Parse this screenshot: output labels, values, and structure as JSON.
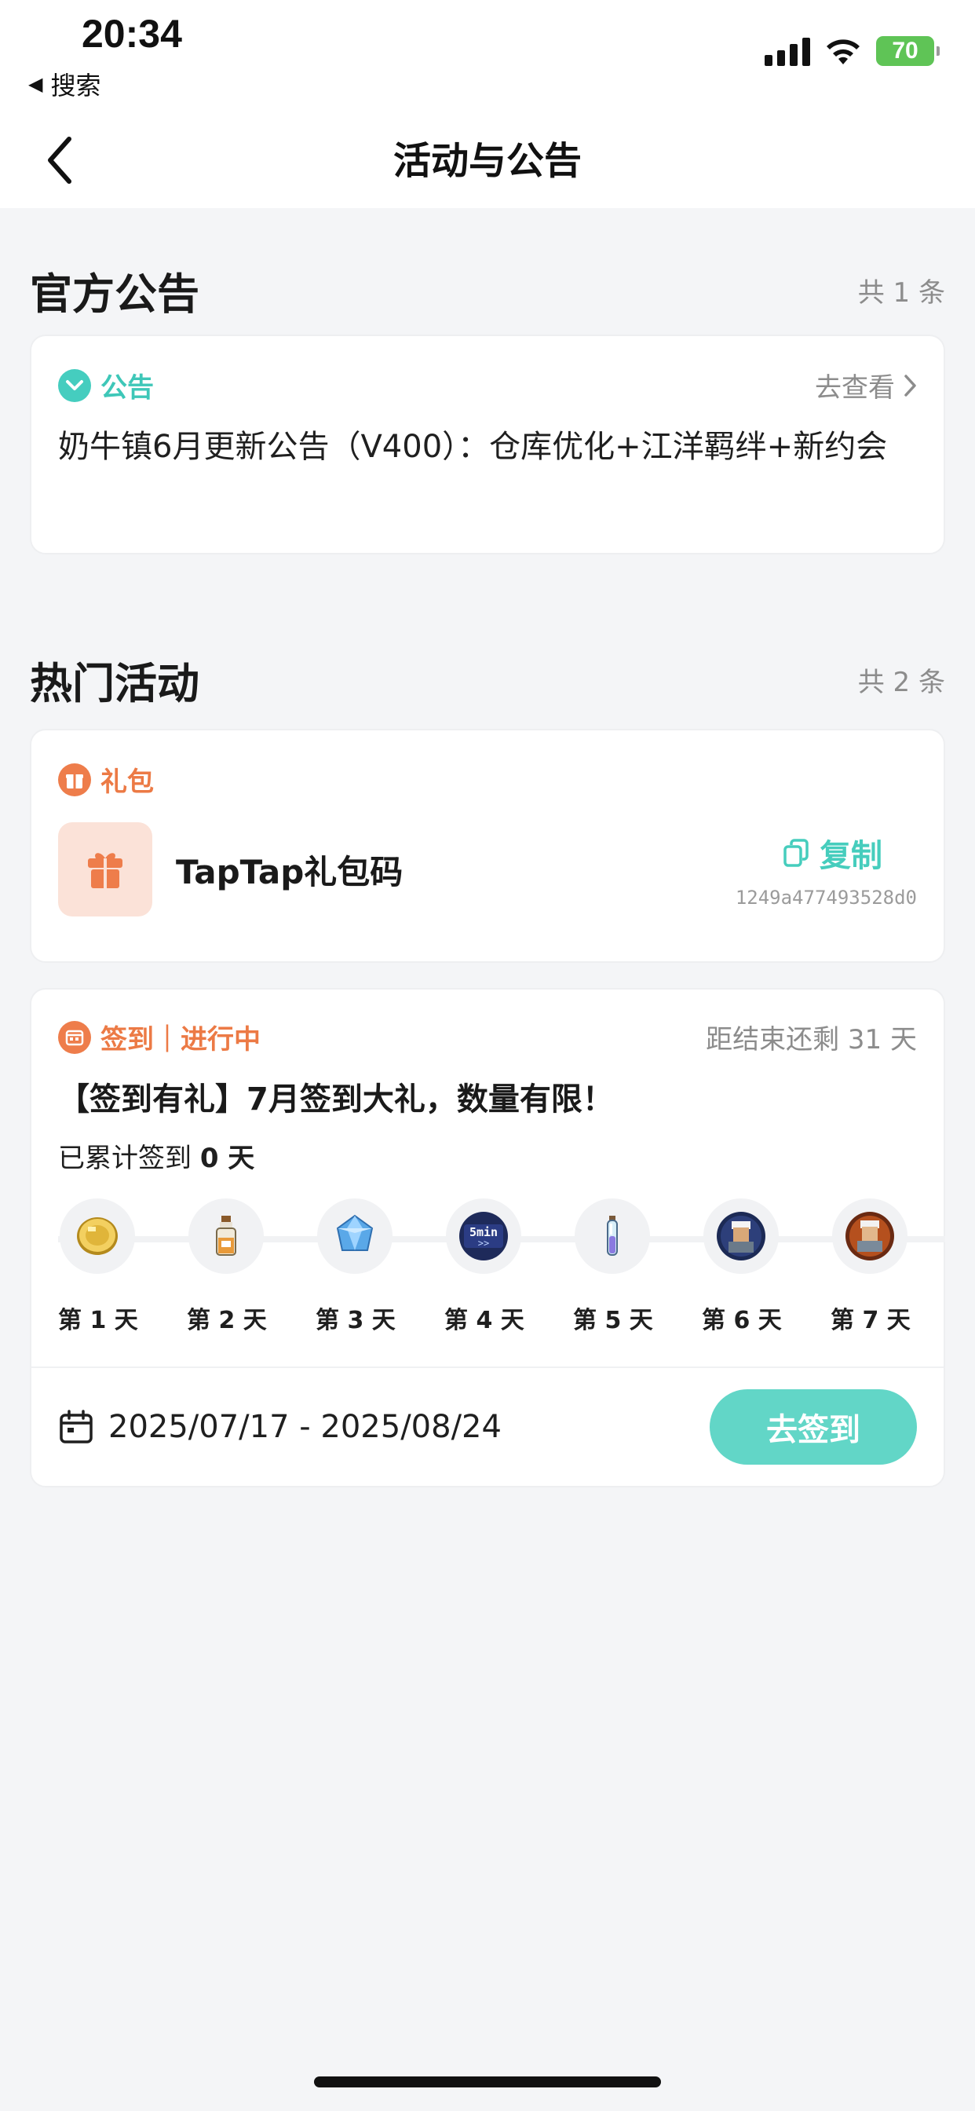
{
  "status_bar": {
    "time": "20:34",
    "back_label": "搜索",
    "battery": "70"
  },
  "nav": {
    "title": "活动与公告"
  },
  "announcements": {
    "title": "官方公告",
    "count": "共 1 条",
    "card": {
      "tag": "公告",
      "more_label": "去查看",
      "text": "奶牛镇6月更新公告（V400）：仓库优化+江洋羁绊+新约会"
    }
  },
  "activities": {
    "title": "热门活动",
    "count": "共 2 条",
    "gift": {
      "tag": "礼包",
      "name": "TapTap礼包码",
      "copy_label": "复制",
      "code": "1249a477493528d0"
    },
    "signin": {
      "tag": "签到｜进行中",
      "remaining": "距结束还剩 31 天",
      "title": "【签到有礼】7月签到大礼，数量有限！",
      "progress_prefix": "已累计签到",
      "progress_value": "0 天",
      "days": [
        {
          "label": "第 1 天",
          "icon": "gold-coin-icon"
        },
        {
          "label": "第 2 天",
          "icon": "milk-bottle-icon"
        },
        {
          "label": "第 3 天",
          "icon": "blue-crystal-icon"
        },
        {
          "label": "第 4 天",
          "icon": "time-skip-icon",
          "icon_text": "5min"
        },
        {
          "label": "第 5 天",
          "icon": "potion-vial-icon"
        },
        {
          "label": "第 6 天",
          "icon": "character-portrait-icon"
        },
        {
          "label": "第 7 天",
          "icon": "character-portrait-icon"
        }
      ],
      "date_range": "2025/07/17 - 2025/08/24",
      "button_label": "去签到"
    }
  },
  "colors": {
    "accent_teal": "#46cdbd",
    "accent_orange": "#ec7a45",
    "background": "#f4f5f7"
  }
}
